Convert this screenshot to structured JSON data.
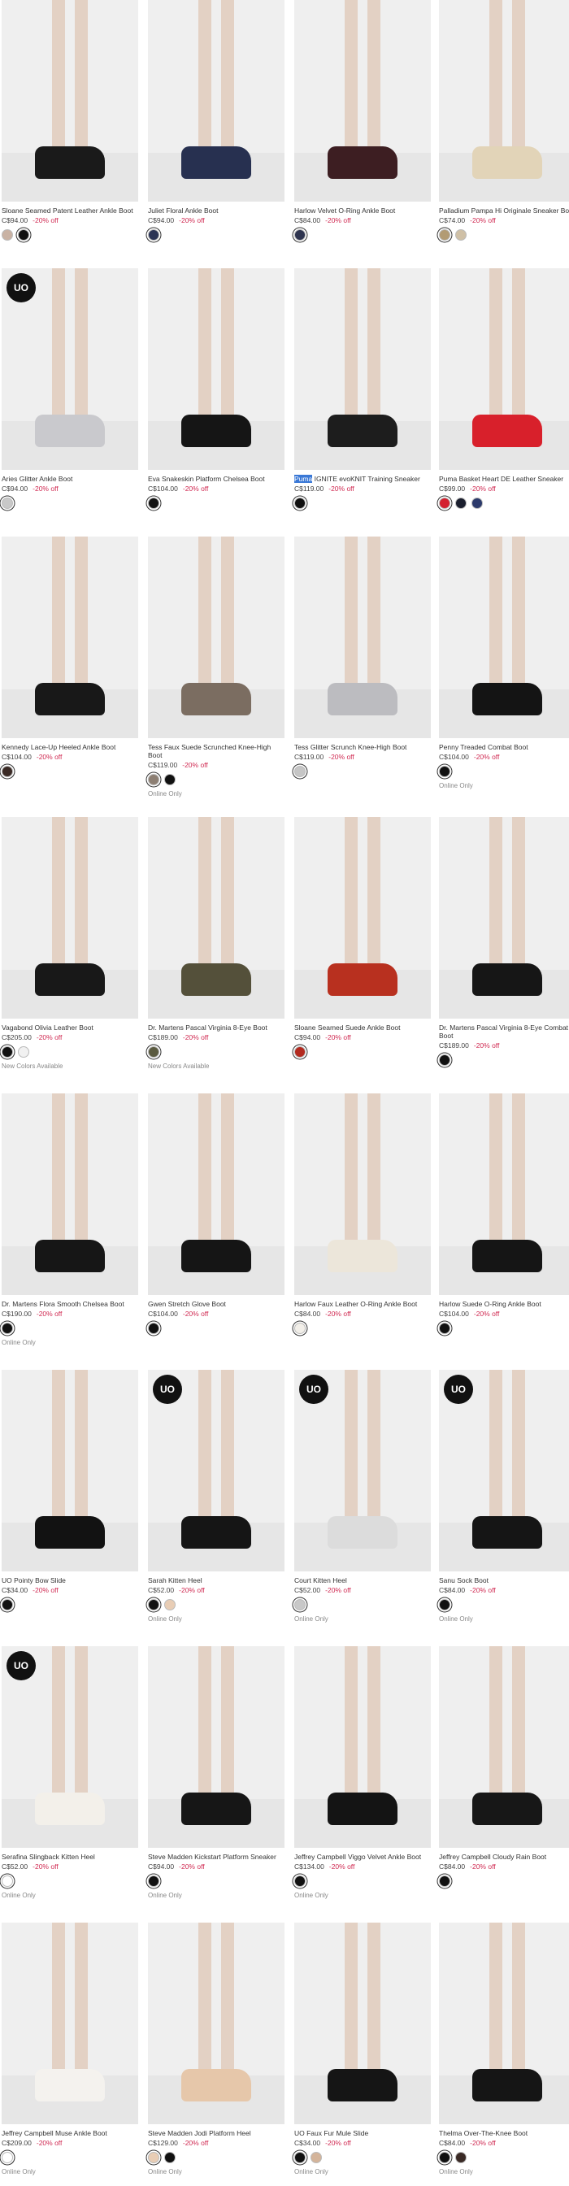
{
  "products": [
    {
      "name": "Sloane Seamed Patent Leather Ankle Boot",
      "price": "C$94.00",
      "discount": "-20% off",
      "colors": [
        "#c9b2a3",
        "#111111"
      ],
      "selected": 1,
      "note": "",
      "badge": "",
      "shoe": "#1a1a1a"
    },
    {
      "name": "Juliet Floral Ankle Boot",
      "price": "C$94.00",
      "discount": "-20% off",
      "colors": [
        "#2b3455"
      ],
      "selected": 0,
      "note": "",
      "badge": "",
      "shoe": "#273050"
    },
    {
      "name": "Harlow Velvet O-Ring Ankle Boot",
      "price": "C$84.00",
      "discount": "-20% off",
      "colors": [
        "#2f3550"
      ],
      "selected": 0,
      "note": "",
      "badge": "",
      "shoe": "#3d1e22"
    },
    {
      "name": "Palladium Pampa Hi Originale Sneaker Boot",
      "price": "C$74.00",
      "discount": "-20% off",
      "colors": [
        "#b29b74",
        "#cfc0a6"
      ],
      "selected": 0,
      "note": "",
      "badge": "",
      "shoe": "#e2d4b8"
    },
    {
      "name": "Aries Glitter Ankle Boot",
      "price": "C$94.00",
      "discount": "-20% off",
      "colors": [
        "#c8c8c8"
      ],
      "selected": 0,
      "note": "",
      "badge": "UO",
      "shoe": "#c9c9cd"
    },
    {
      "name": "Eva Snakeskin Platform Chelsea Boot",
      "price": "C$104.00",
      "discount": "-20% off",
      "colors": [
        "#111111"
      ],
      "selected": 0,
      "note": "",
      "badge": "",
      "shoe": "#151515"
    },
    {
      "name_hl": "Puma",
      "name": " IGNITE evoKNIT Training Sneaker",
      "price": "C$119.00",
      "discount": "-20% off",
      "colors": [
        "#111111"
      ],
      "selected": 0,
      "note": "",
      "badge": "",
      "shoe": "#1d1d1d"
    },
    {
      "name": "Puma Basket Heart DE Leather Sneaker",
      "price": "C$99.00",
      "discount": "-20% off",
      "colors": [
        "#d3202f",
        "#1b1f2e",
        "#2c3a6b"
      ],
      "selected": 0,
      "note": "",
      "badge": "",
      "shoe": "#d8202b"
    },
    {
      "name": "Kennedy Lace-Up Heeled Ankle Boot",
      "price": "C$104.00",
      "discount": "-20% off",
      "colors": [
        "#3a2a25"
      ],
      "selected": 0,
      "note": "",
      "badge": "",
      "shoe": "#181818"
    },
    {
      "name": "Tess Faux Suede Scrunched Knee-High Boot",
      "price": "C$119.00",
      "discount": "-20% off",
      "colors": [
        "#8d7f73",
        "#111111"
      ],
      "selected": 0,
      "note": "Online Only",
      "badge": "",
      "shoe": "#7b6d61"
    },
    {
      "name": "Tess Glitter Scrunch Knee-High Boot",
      "price": "C$119.00",
      "discount": "-20% off",
      "colors": [
        "#c6c6c6"
      ],
      "selected": 0,
      "note": "",
      "badge": "",
      "shoe": "#bcbcc0"
    },
    {
      "name": "Penny Treaded Combat Boot",
      "price": "C$104.00",
      "discount": "-20% off",
      "colors": [
        "#111111"
      ],
      "selected": 0,
      "note": "Online Only",
      "badge": "",
      "shoe": "#141414"
    },
    {
      "name": "Vagabond Olivia Leather Boot",
      "price": "C$205.00",
      "discount": "-20% off",
      "colors": [
        "#111111",
        "#f1f1f1"
      ],
      "selected": 0,
      "note": "New Colors Available",
      "badge": "",
      "shoe": "#181818"
    },
    {
      "name": "Dr. Martens Pascal Virginia 8-Eye Boot",
      "price": "C$189.00",
      "discount": "-20% off",
      "colors": [
        "#5b5b40"
      ],
      "selected": 0,
      "note": "New Colors Available",
      "badge": "",
      "shoe": "#54503a"
    },
    {
      "name": "Sloane Seamed Suede Ankle Boot",
      "price": "C$94.00",
      "discount": "-20% off",
      "colors": [
        "#b32a1f"
      ],
      "selected": 0,
      "note": "",
      "badge": "",
      "shoe": "#b8301f"
    },
    {
      "name": "Dr. Martens Pascal Virginia 8-Eye Combat Boot",
      "price": "C$189.00",
      "discount": "-20% off",
      "colors": [
        "#111111"
      ],
      "selected": 0,
      "note": "",
      "badge": "",
      "shoe": "#161616"
    },
    {
      "name": "Dr. Martens Flora Smooth Chelsea Boot",
      "price": "C$190.00",
      "discount": "-20% off",
      "colors": [
        "#111111"
      ],
      "selected": 0,
      "note": "Online Only",
      "badge": "",
      "shoe": "#161616"
    },
    {
      "name": "Gwen Stretch Glove Boot",
      "price": "C$104.00",
      "discount": "-20% off",
      "colors": [
        "#111111"
      ],
      "selected": 0,
      "note": "",
      "badge": "",
      "shoe": "#151515"
    },
    {
      "name": "Harlow Faux Leather O-Ring Ankle Boot",
      "price": "C$84.00",
      "discount": "-20% off",
      "colors": [
        "#f2efe9"
      ],
      "selected": 0,
      "note": "",
      "badge": "",
      "shoe": "#ece6da"
    },
    {
      "name": "Harlow Suede O-Ring Ankle Boot",
      "price": "C$104.00",
      "discount": "-20% off",
      "colors": [
        "#111111"
      ],
      "selected": 0,
      "note": "",
      "badge": "",
      "shoe": "#151515"
    },
    {
      "name": "UO Pointy Bow Slide",
      "price": "C$34.00",
      "discount": "-20% off",
      "colors": [
        "#111111"
      ],
      "selected": 0,
      "note": "",
      "badge": "",
      "shoe": "#121212"
    },
    {
      "name": "Sarah Kitten Heel",
      "price": "C$52.00",
      "discount": "-20% off",
      "colors": [
        "#111111",
        "#e8cdb5"
      ],
      "selected": 0,
      "note": "Online Only",
      "badge": "UO",
      "shoe": "#151515"
    },
    {
      "name": "Court Kitten Heel",
      "price": "C$52.00",
      "discount": "-20% off",
      "colors": [
        "#c8c8c8"
      ],
      "selected": 0,
      "note": "Online Only",
      "badge": "UO",
      "shoe": "#dcdcdc"
    },
    {
      "name": "Sanu Sock Boot",
      "price": "C$84.00",
      "discount": "-20% off",
      "colors": [
        "#111111"
      ],
      "selected": 0,
      "note": "Online Only",
      "badge": "UO",
      "shoe": "#151515"
    },
    {
      "name": "Serafina Slingback Kitten Heel",
      "price": "C$52.00",
      "discount": "-20% off",
      "colors": [
        "#ffffff"
      ],
      "selected": 0,
      "note": "Online Only",
      "badge": "UO",
      "shoe": "#f3f0ea"
    },
    {
      "name": "Steve Madden Kickstart Platform Sneaker",
      "price": "C$94.00",
      "discount": "-20% off",
      "colors": [
        "#111111"
      ],
      "selected": 0,
      "note": "Online Only",
      "badge": "",
      "shoe": "#161616"
    },
    {
      "name": "Jeffrey Campbell Viggo Velvet Ankle Boot",
      "price": "C$134.00",
      "discount": "-20% off",
      "colors": [
        "#111111"
      ],
      "selected": 0,
      "note": "Online Only",
      "badge": "",
      "shoe": "#141414"
    },
    {
      "name": "Jeffrey Campbell Cloudy Rain Boot",
      "price": "C$84.00",
      "discount": "-20% off",
      "colors": [
        "#111111"
      ],
      "selected": 0,
      "note": "",
      "badge": "",
      "shoe": "#171717"
    },
    {
      "name": "Jeffrey Campbell Muse Ankle Boot",
      "price": "C$209.00",
      "discount": "-20% off",
      "colors": [
        "#ffffff"
      ],
      "selected": 0,
      "note": "Online Only",
      "badge": "",
      "shoe": "#f4f2ee"
    },
    {
      "name": "Steve Madden Jodi Platform Heel",
      "price": "C$129.00",
      "discount": "-20% off",
      "colors": [
        "#e8cdb5",
        "#111111"
      ],
      "selected": 0,
      "note": "Online Only",
      "badge": "",
      "shoe": "#e6c7aa"
    },
    {
      "name": "UO Faux Fur Mule Slide",
      "price": "C$34.00",
      "discount": "-20% off",
      "colors": [
        "#111111",
        "#d4b49a"
      ],
      "selected": 0,
      "note": "Online Only",
      "badge": "",
      "shoe": "#151515"
    },
    {
      "name": "Thelma Over-The-Knee Boot",
      "price": "C$84.00",
      "discount": "-20% off",
      "colors": [
        "#111111",
        "#3a2a25"
      ],
      "selected": 0,
      "note": "Online Only",
      "badge": "",
      "shoe": "#151515"
    }
  ]
}
